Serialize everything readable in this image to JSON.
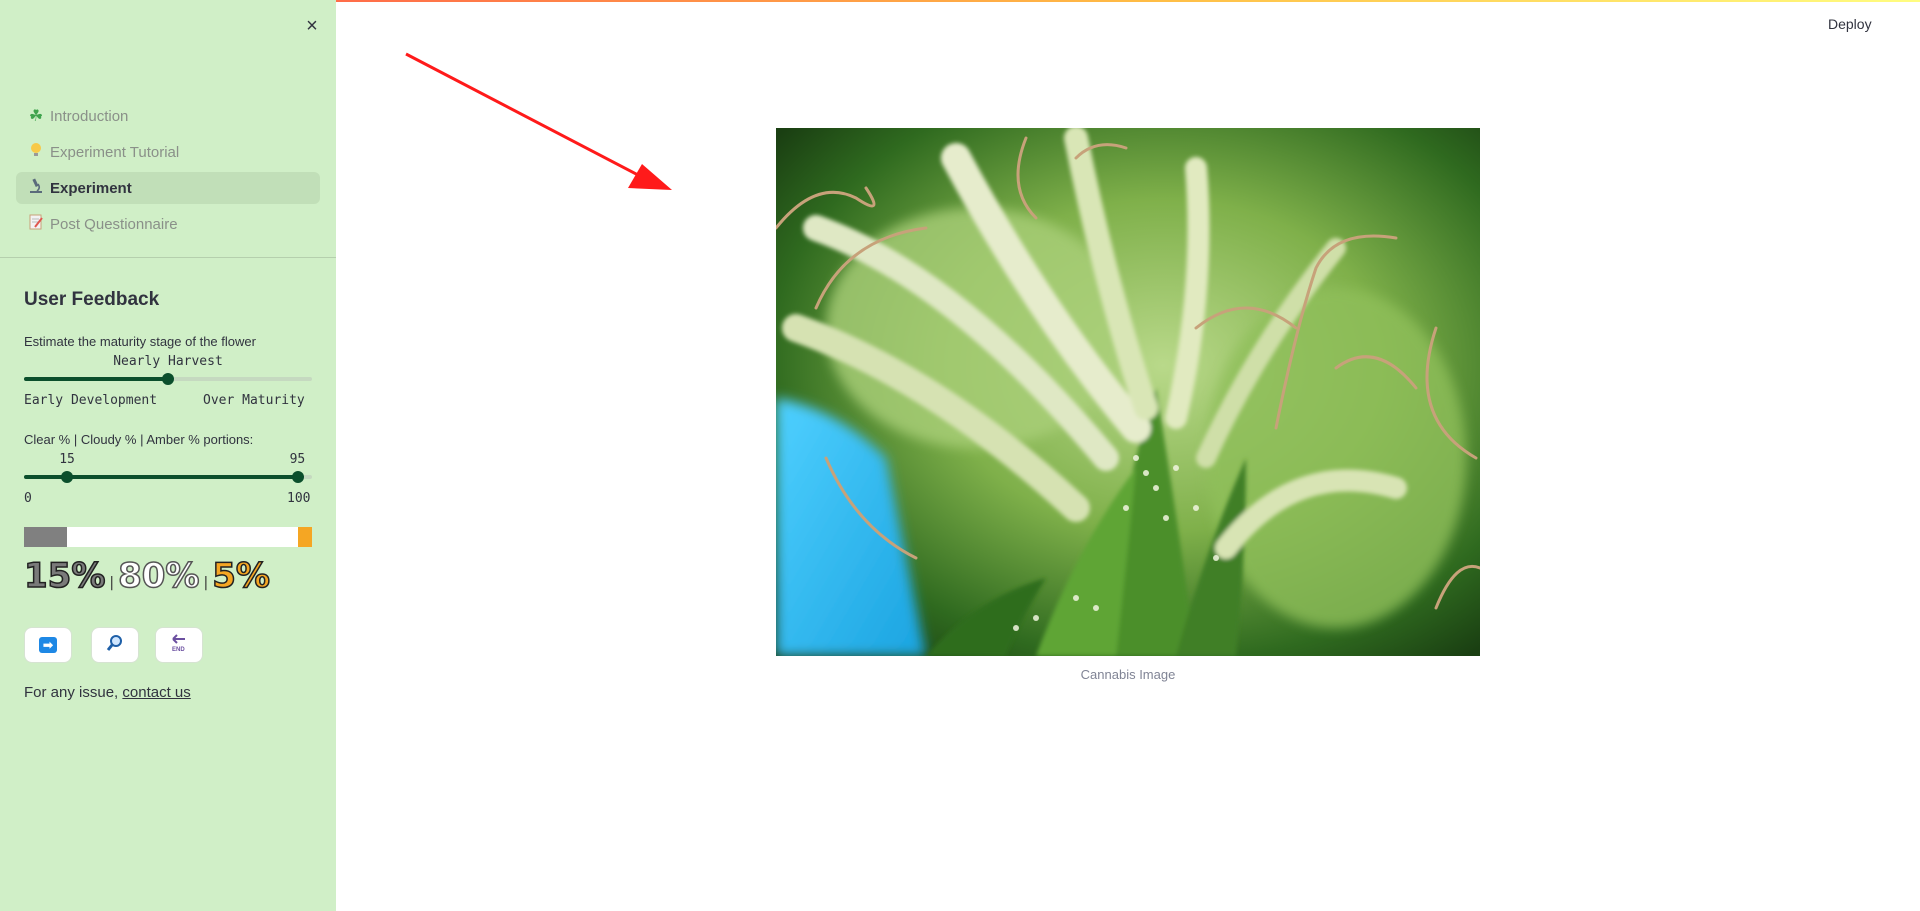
{
  "sidebar": {
    "close_label": "×",
    "nav": [
      {
        "icon": "shamrock-icon",
        "glyph": "☘",
        "label": "Introduction",
        "active": false
      },
      {
        "icon": "lightbulb-icon",
        "glyph": "💡",
        "label": "Experiment Tutorial",
        "active": false
      },
      {
        "icon": "microscope-icon",
        "glyph": "🔬",
        "label": "Experiment",
        "active": true
      },
      {
        "icon": "memo-icon",
        "glyph": "📝",
        "label": "Post Questionnaire",
        "active": false
      }
    ],
    "feedback": {
      "title": "User Feedback",
      "maturity": {
        "label": "Estimate the maturity stage of the flower",
        "value": "Nearly Harvest",
        "min_label": "Early Development",
        "max_label": "Over Maturity",
        "level": 0.5
      },
      "portions": {
        "label": "Clear % | Cloudy % | Amber % portions:",
        "low": 15,
        "high": 95,
        "min": 0,
        "max": 100,
        "low_label": "15",
        "high_label": "95",
        "min_label": "0",
        "max_label": "100"
      },
      "percentages": {
        "clear": "15%",
        "cloudy": "80%",
        "amber": "5%",
        "separator": "|"
      },
      "colors": {
        "clear": "#808080",
        "cloudy": "#ffffff",
        "amber": "#f5a623",
        "slider": "#0b4f2c"
      },
      "buttons": [
        {
          "name": "next-arrow-button",
          "icon": "right-arrow-icon",
          "glyph": "➡",
          "color": "#1e88e5"
        },
        {
          "name": "zoom-button",
          "icon": "magnifier-icon",
          "glyph": "🔎",
          "color": "#ffffff"
        },
        {
          "name": "end-button",
          "icon": "end-arrow-icon",
          "glyph": "END",
          "color": "#7e57c2"
        }
      ],
      "issue_text": "For any issue,",
      "contact_link": "contact us"
    }
  },
  "header": {
    "deploy_label": "Deploy"
  },
  "main": {
    "image_caption": "Cannabis Image",
    "arrow_color": "#ff1a1a"
  }
}
